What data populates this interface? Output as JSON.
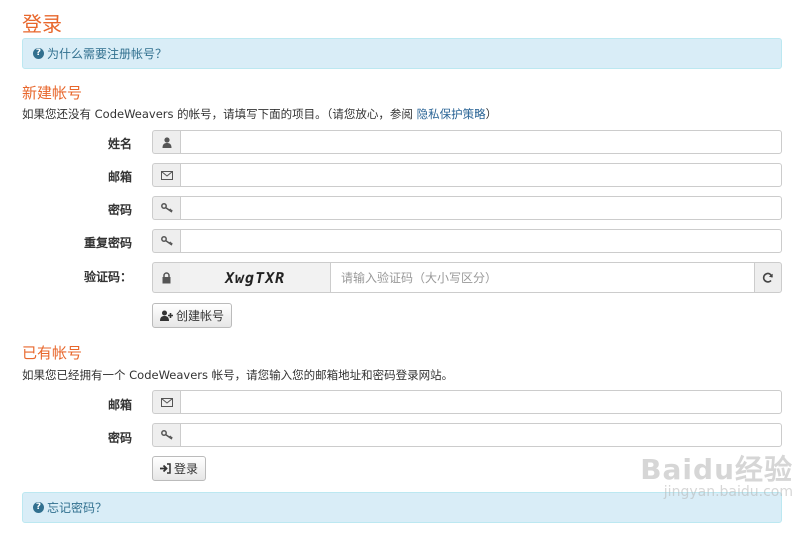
{
  "page": {
    "title": "登录"
  },
  "info_top": {
    "text": "为什么需要注册帐号？"
  },
  "new_account": {
    "title": "新建帐号",
    "desc": "如果您还没有 CodeWeavers 的帐号，请填写下面的项目。（请您放心，参阅 ",
    "desc_link": "隐私保护策略",
    "desc_end": "）",
    "fields": {
      "name_label": "姓名",
      "email_label": "邮箱",
      "password_label": "密码",
      "repeat_password_label": "重复密码",
      "captcha_label": "验证码："
    },
    "captcha": {
      "image_text": "XwgTXR",
      "placeholder": "请输入验证码（大小写区分）"
    },
    "create_button": "创建帐号"
  },
  "existing_account": {
    "title": "已有帐号",
    "desc": "如果您已经拥有一个 CodeWeavers 帐号，请您输入您的邮箱地址和密码登录网站。",
    "email_label": "邮箱",
    "password_label": "密码",
    "login_button": "登录"
  },
  "info_bottom": {
    "text": "忘记密码？"
  },
  "watermark": {
    "main": "Baidu经验",
    "sub": "jingyan.baidu.com"
  },
  "colors": {
    "accent": "#e8672c",
    "info_bg": "#d9edf7",
    "info_text": "#31708f"
  }
}
